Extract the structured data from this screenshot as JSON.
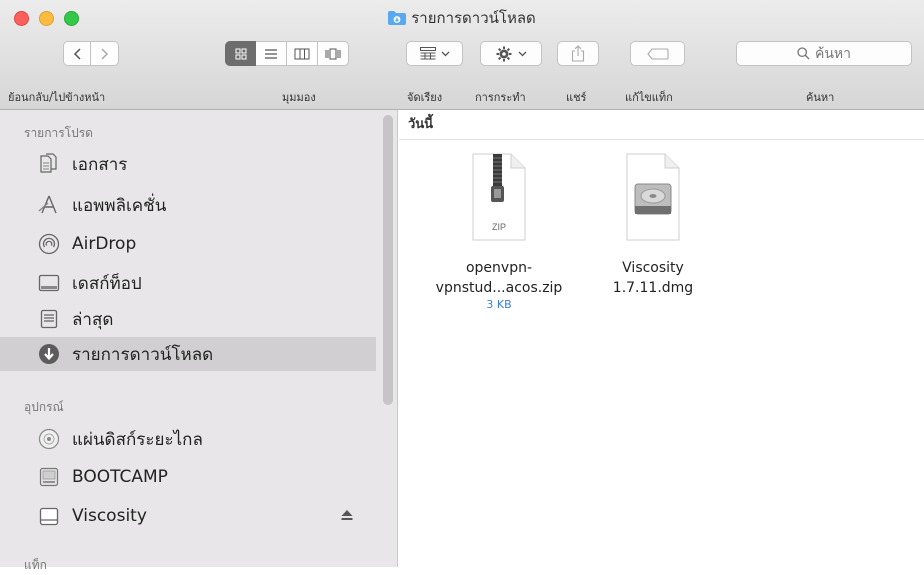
{
  "window": {
    "title": "รายการดาวน์โหลด"
  },
  "toolbar": {
    "back_forward_label": "ย้อนกลับ/ไปข้างหน้า",
    "view_label": "มุมมอง",
    "arrange_label": "จัดเรียง",
    "action_label": "การกระทำ",
    "share_label": "แชร์",
    "tags_label": "แก้ไขแท็ก",
    "search_label": "ค้นหา",
    "search_placeholder": "ค้นหา"
  },
  "sidebar": {
    "favorites_header": "รายการโปรด",
    "favorites": [
      {
        "label": "เอกสาร",
        "icon": "documents-icon"
      },
      {
        "label": "แอพพลิเคชั่น",
        "icon": "applications-icon"
      },
      {
        "label": "AirDrop",
        "icon": "airdrop-icon"
      },
      {
        "label": "เดสก์ท็อป",
        "icon": "desktop-icon"
      },
      {
        "label": "ล่าสุด",
        "icon": "recents-icon"
      },
      {
        "label": "รายการดาวน์โหลด",
        "icon": "downloads-icon",
        "selected": true
      }
    ],
    "devices_header": "อุปกรณ์",
    "devices": [
      {
        "label": "แผ่นดิสก์ระยะไกล",
        "icon": "remote-disc-icon"
      },
      {
        "label": "BOOTCAMP",
        "icon": "drive-icon"
      },
      {
        "label": "Viscosity",
        "icon": "disk-image-icon",
        "ejectable": true
      }
    ],
    "tags_header": "แท็ก"
  },
  "content": {
    "group_header": "วันนี้",
    "files": [
      {
        "name_line1": "openvpn-",
        "name_line2": "vpnstud...acos.zip",
        "size": "3 KB",
        "type_badge": "ZIP",
        "icon": "zip-file-icon"
      },
      {
        "name_line1": "Viscosity",
        "name_line2": "1.7.11.dmg",
        "size": "",
        "icon": "dmg-file-icon"
      }
    ]
  },
  "colors": {
    "selection": "#d1cfd1",
    "sidebar_bg": "#e8e6e8",
    "size_text": "#3b7ddd",
    "close": "#fc605c",
    "minimize": "#fdbc40",
    "zoom": "#34c84a"
  }
}
